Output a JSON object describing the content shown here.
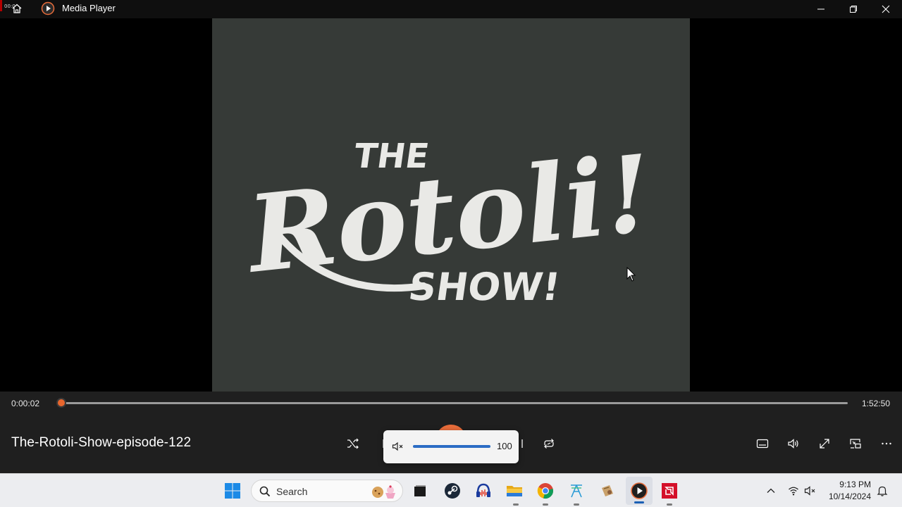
{
  "titlebar": {
    "app_name": "Media Player",
    "corner_text": "00:0",
    "buttons": [
      "minimize-icon",
      "restore-icon",
      "close-icon"
    ]
  },
  "video": {
    "title_line_1": "THE",
    "title_line_2": "Rotoli!",
    "title_line_3": "SHOW!",
    "background_color": "#363a37",
    "text_color": "#e9e9e6"
  },
  "playback": {
    "current_time": "0:00:02",
    "total_time": "1:52:50",
    "progress_fraction": 0.0003,
    "accent_color": "#e8662d"
  },
  "media": {
    "title": "The-Rotoli-Show-episode-122"
  },
  "volume_flyout": {
    "muted": true,
    "value": "100"
  },
  "controls": [
    "shuffle-icon",
    "previous-icon",
    "play-pause-button",
    "next-icon",
    "repeat-icon",
    "captions-icon",
    "volume-icon",
    "fullscreen-icon",
    "miniplayer-icon",
    "more-options-icon"
  ],
  "taskbar": {
    "search_label": "Search",
    "time": "9:13 PM",
    "date": "10/14/2024",
    "pinned": [
      "windows-start-icon",
      "task-view-icon",
      "steam-icon",
      "audacity-icon",
      "file-explorer-icon",
      "chrome-icon",
      "app-icon",
      "app-icon-2",
      "media-player-icon",
      "amd-icon"
    ],
    "tray": [
      "chevron-up-icon",
      "wifi-icon",
      "speaker-muted-icon",
      "notification-bell-icon"
    ]
  }
}
